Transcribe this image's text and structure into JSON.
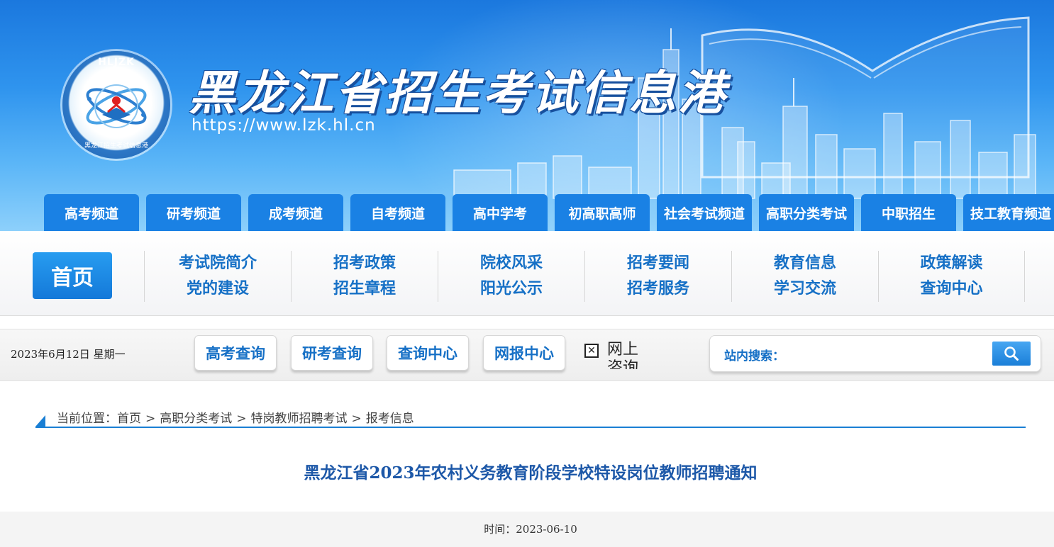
{
  "header": {
    "logo_top": "HLJZK",
    "logo_bottom": "黑龙江招生考试信息港",
    "site_title": "黑龙江省招生考试信息港",
    "site_url": "https://www.lzk.hl.cn",
    "channels": [
      "高考频道",
      "研考频道",
      "成考频道",
      "自考频道",
      "高中学考",
      "初高职高师",
      "社会考试频道",
      "高职分类考试",
      "中职招生",
      "技工教育频道"
    ]
  },
  "mainnav": {
    "home": "首页",
    "columns": [
      [
        "考试院简介",
        "党的建设"
      ],
      [
        "招考政策",
        "招生章程"
      ],
      [
        "院校风采",
        "阳光公示"
      ],
      [
        "招考要闻",
        "招考服务"
      ],
      [
        "教育信息",
        "学习交流"
      ],
      [
        "政策解读",
        "查询中心"
      ]
    ]
  },
  "toolbar": {
    "date": "2023年6月12日  星期一",
    "quick_links": [
      "高考查询",
      "研考查询",
      "查询中心",
      "网报中心"
    ],
    "consult_text": "网上咨询",
    "broken_image_glyph": "✕",
    "search_label": "站内搜索：",
    "search_placeholder": ""
  },
  "content": {
    "breadcrumb_prefix": "当前位置：",
    "breadcrumb": [
      "首页",
      "高职分类考试",
      "特岗教师招聘考试",
      "报考信息"
    ],
    "breadcrumb_separator": ">",
    "title": "黑龙江省2023年农村义务教育阶段学校特设岗位教师招聘通知",
    "meta": "时间：2023-06-10"
  },
  "colors": {
    "brand_blue": "#1a81e4",
    "link_blue": "#1670c6",
    "title_blue": "#1d58a8"
  }
}
